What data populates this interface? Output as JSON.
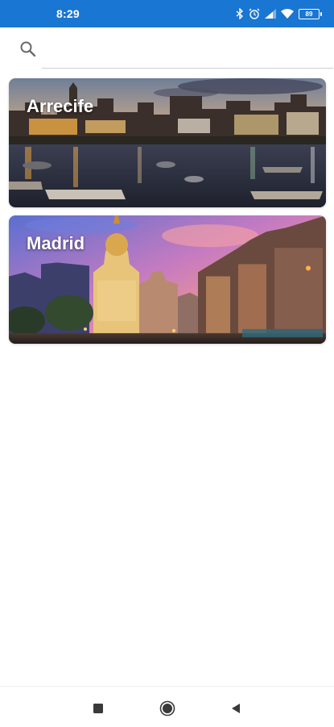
{
  "status_bar": {
    "time": "8:29",
    "battery_level": "89",
    "icons": [
      "bluetooth-icon",
      "alarm-icon",
      "signal-icon",
      "wifi-icon",
      "battery-icon"
    ],
    "color": "#1976d2"
  },
  "search": {
    "placeholder": "",
    "value": "",
    "icon": "search-icon"
  },
  "cities": [
    {
      "name": "Arrecife"
    },
    {
      "name": "Madrid"
    }
  ],
  "nav_bar": {
    "buttons": [
      "recent-apps-icon",
      "home-icon",
      "back-icon"
    ]
  }
}
